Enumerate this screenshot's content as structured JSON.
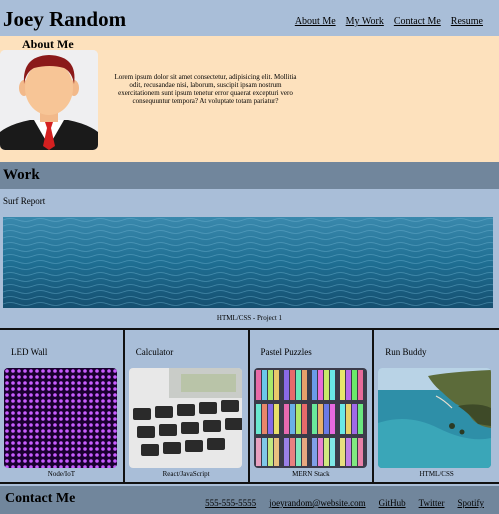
{
  "header": {
    "brand": "Joey Random",
    "nav": [
      "About Me",
      "My Work",
      "Contact Me",
      "Resume"
    ]
  },
  "about": {
    "title": "About Me",
    "text": "Lorem ipsum dolor sit amet consectetur, adipisicing elit. Mollitia odit, recusandae nisi, laborum, suscipit ipsam nostrum exercitationem sunt ipsum tenetur error quaerat excepturi vero consequuntur tempora? At voluptate totam pariatur?"
  },
  "work": {
    "title": "Work",
    "featured": {
      "title": "Surf Report",
      "caption": "HTML/CSS - Project 1"
    },
    "projects": [
      {
        "title": "LED Wall",
        "caption": "Node/IoT"
      },
      {
        "title": "Calculator",
        "caption": "React/JavaScript"
      },
      {
        "title": "Pastel Puzzles",
        "caption": "MERN Stack"
      },
      {
        "title": "Run Buddy",
        "caption": "HTML/CSS"
      }
    ]
  },
  "contact": {
    "title": "Contact Me",
    "links": [
      "555-555-5555",
      "joeyrandom@website.com",
      "GitHub",
      "Twitter",
      "Spotify"
    ]
  },
  "colors": {
    "background": "#a9bed8",
    "about_background": "#fde1bd",
    "section_bar": "#71869c"
  }
}
